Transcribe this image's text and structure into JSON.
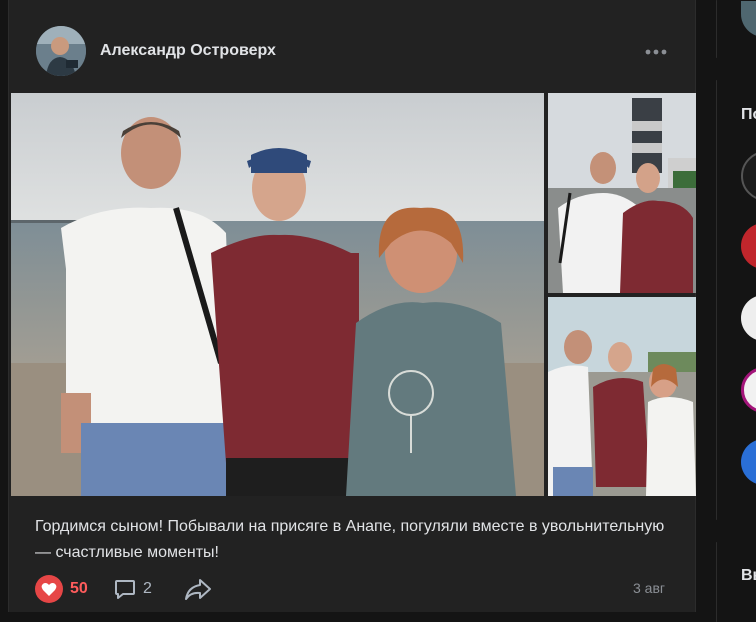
{
  "post": {
    "author": "Александр Островерх",
    "more_label": "•••",
    "caption": "Гордимся сыном! Побывали на присяге в Анапе, погуляли вместе в увольнительную — счастливые моменты!",
    "likes": "50",
    "comments": "2",
    "date": "3 авг"
  },
  "sidebar": {
    "card2_title": "По",
    "card3_title": "Вы"
  },
  "colors": {
    "background": "#141414",
    "card": "#222222",
    "like": "#e64646",
    "like_count": "#ff5c5c",
    "muted": "#8b8f95"
  }
}
